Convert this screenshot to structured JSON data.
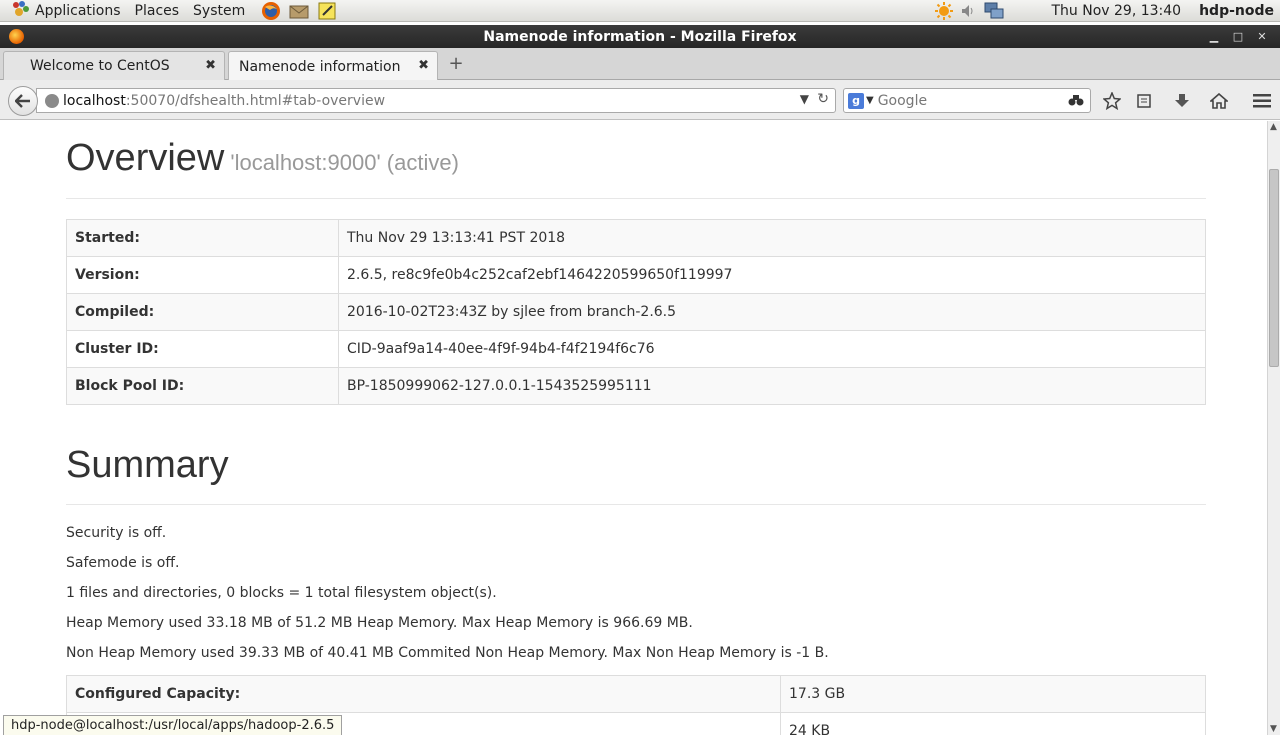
{
  "panel": {
    "applications": "Applications",
    "places": "Places",
    "system": "System",
    "clock": "Thu Nov 29, 13:40",
    "hostname": "hdp-node"
  },
  "window": {
    "title": "Namenode information - Mozilla Firefox"
  },
  "tabs": [
    {
      "label": "Welcome to CentOS"
    },
    {
      "label": "Namenode information"
    }
  ],
  "urlbar": {
    "host": "localhost",
    "path": ":50070/dfshealth.html#tab-overview"
  },
  "search": {
    "placeholder": "Google"
  },
  "overview": {
    "title": "Overview",
    "subtitle": "'localhost:9000' (active)",
    "rows": [
      {
        "key": "Started:",
        "value": "Thu Nov 29 13:13:41 PST 2018"
      },
      {
        "key": "Version:",
        "value": "2.6.5, re8c9fe0b4c252caf2ebf1464220599650f119997"
      },
      {
        "key": "Compiled:",
        "value": "2016-10-02T23:43Z by sjlee from branch-2.6.5"
      },
      {
        "key": "Cluster ID:",
        "value": "CID-9aaf9a14-40ee-4f9f-94b4-f4f2194f6c76"
      },
      {
        "key": "Block Pool ID:",
        "value": "BP-1850999062-127.0.0.1-1543525995111"
      }
    ]
  },
  "summary": {
    "title": "Summary",
    "lines": [
      "Security is off.",
      "Safemode is off.",
      "1 files and directories, 0 blocks = 1 total filesystem object(s).",
      "Heap Memory used 33.18 MB of 51.2 MB Heap Memory. Max Heap Memory is 966.69 MB.",
      "Non Heap Memory used 39.33 MB of 40.41 MB Commited Non Heap Memory. Max Non Heap Memory is -1 B."
    ],
    "rows": [
      {
        "key": "Configured Capacity:",
        "value": "17.3 GB"
      },
      {
        "key": "",
        "value": "24 KB"
      }
    ]
  },
  "statusbar": {
    "text": "hdp-node@localhost:/usr/local/apps/hadoop-2.6.5"
  },
  "icons": {
    "applications": "gnome-foot-icon",
    "firefox": "firefox-icon",
    "weather": "sun-icon",
    "volume": "speaker-icon",
    "network": "network-icon"
  }
}
